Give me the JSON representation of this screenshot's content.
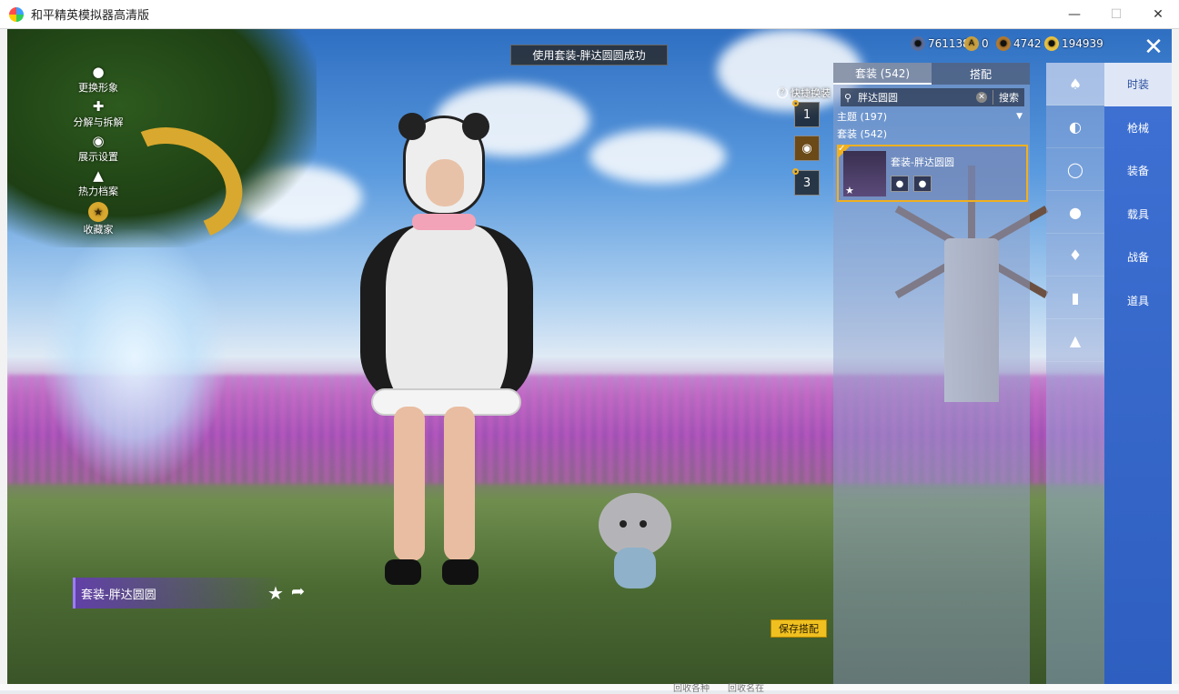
{
  "window": {
    "title": "和平精英模拟器高清版"
  },
  "toast": "使用套装-胖达圆圆成功",
  "left_menu": [
    {
      "label": "更换形象",
      "icon": "person-icon"
    },
    {
      "label": "分解与拆解",
      "icon": "puzzle-icon"
    },
    {
      "label": "展示设置",
      "icon": "eye-icon"
    },
    {
      "label": "热力档案",
      "icon": "flame-icon"
    },
    {
      "label": "收藏家",
      "icon": "collector-icon"
    }
  ],
  "currencies": [
    {
      "value": "761138",
      "color": "#5a6d9a",
      "icon": "coupon-icon"
    },
    {
      "value": "0",
      "color": "#c9a040",
      "icon": "token-a-icon"
    },
    {
      "value": "4742",
      "color": "#b07830",
      "icon": "token-b-icon"
    },
    {
      "value": "194939",
      "color": "#e8c040",
      "icon": "gold-coin-icon"
    }
  ],
  "quick_change": {
    "label": "快捷换装",
    "slots": [
      "1",
      "",
      "3"
    ]
  },
  "panel": {
    "tabs": [
      {
        "label": "套装 (542)"
      },
      {
        "label": "搭配"
      }
    ],
    "search": {
      "value": "胖达圆圆",
      "button": "搜索"
    },
    "theme_row": "主题 (197)",
    "set_row": "套装 (542)",
    "item": {
      "name": "套装-胖达圆圆"
    }
  },
  "icon_column": [
    "outfit-set-icon",
    "hat-icon",
    "glasses-icon",
    "face-icon",
    "top-icon",
    "pants-icon",
    "shoe-icon"
  ],
  "right_nav": [
    {
      "label": "时装"
    },
    {
      "label": "枪械"
    },
    {
      "label": "装备"
    },
    {
      "label": "载具"
    },
    {
      "label": "战备"
    },
    {
      "label": "道具"
    }
  ],
  "outfit_banner": "套装-胖达圆圆",
  "save_button": "保存搭配",
  "bottom_ghost": [
    "回收各种",
    "回收名在"
  ]
}
